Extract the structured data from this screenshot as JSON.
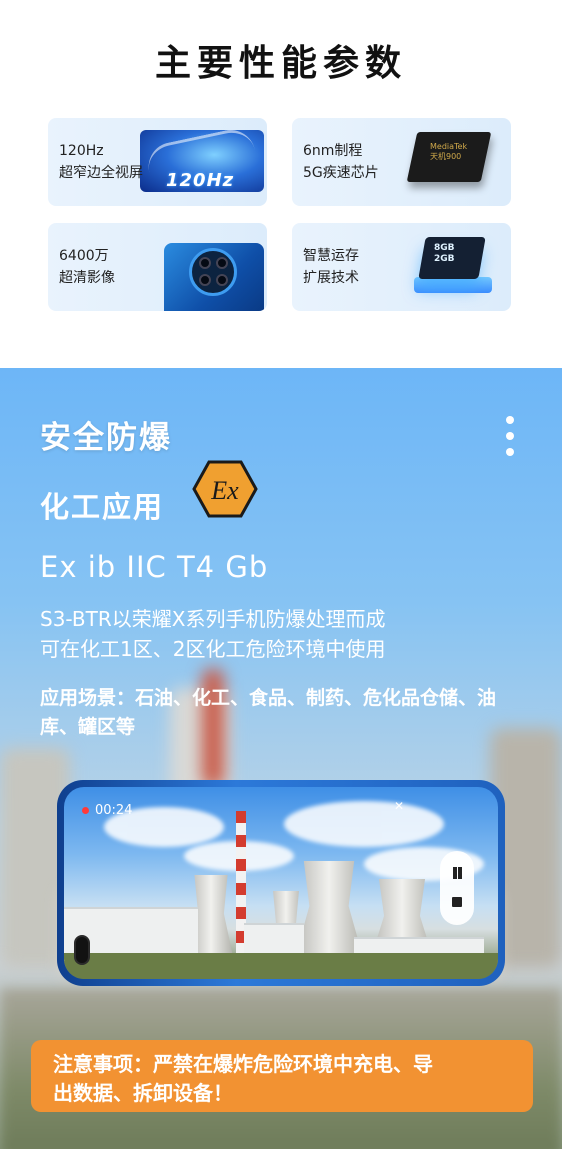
{
  "spec": {
    "title": "主要性能参数",
    "cards": [
      {
        "line1": "120Hz",
        "line2": "超窄边全视屏",
        "art_text": "120Hz"
      },
      {
        "line1": "6nm制程",
        "line2": "5G疾速芯片",
        "art_text_1": "MediaTek",
        "art_text_2": "天机900"
      },
      {
        "line1": "6400万",
        "line2": "超清影像"
      },
      {
        "line1": "智慧运存",
        "line2": "扩展技术",
        "art_text_1": "8GB",
        "art_text_2": "2GB"
      }
    ]
  },
  "safety": {
    "title": "安全防爆",
    "subtitle": "化工应用",
    "ex_badge": "Ex",
    "ex_code": "Ex ib IIC T4 Gb",
    "desc_line1": "S3-BTR以荣耀X系列手机防爆处理而成",
    "desc_line2": "可在化工1区、2区化工危险环境中使用",
    "scenes": "应用场景：石油、化工、食品、制药、危化品仓储、油库、罐区等",
    "rec_time": "00:24",
    "notice_line1": "注意事项：严禁在爆炸危险环境中充电、导",
    "notice_line2": "出数据、拆卸设备！"
  },
  "icons": {
    "more": "more-vertical-icon",
    "ex": "ex-hexagon-icon",
    "pause": "pause-icon",
    "stop": "stop-icon"
  },
  "colors": {
    "accent_orange": "#f29232",
    "sky_blue": "#6db6f7",
    "ex_badge": "#f0a030"
  }
}
